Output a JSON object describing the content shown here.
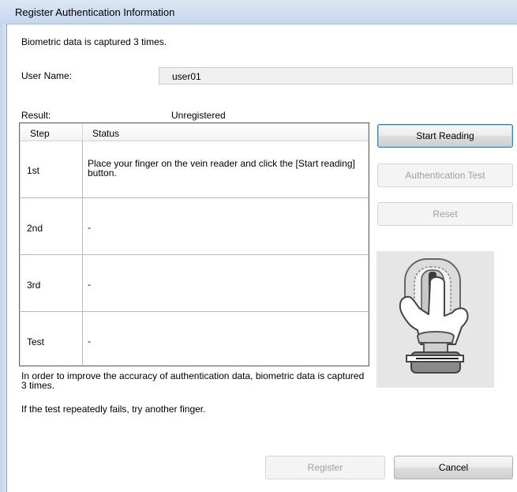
{
  "window": {
    "title": "Register Authentication Information"
  },
  "info": {
    "capture_text": "Biometric data is captured 3 times."
  },
  "user": {
    "label": "User Name:",
    "value": "user01"
  },
  "result": {
    "label": "Result:",
    "value": "Unregistered"
  },
  "table": {
    "headers": [
      "Step",
      "Status"
    ],
    "rows": [
      {
        "step": "1st",
        "status": "Place your finger on the vein reader and click the [Start reading] button."
      },
      {
        "step": "2nd",
        "status": "-"
      },
      {
        "step": "3rd",
        "status": "-"
      },
      {
        "step": "Test",
        "status": "-"
      }
    ]
  },
  "buttons": {
    "start_reading": "Start Reading",
    "auth_test": "Authentication Test",
    "reset": "Reset",
    "register": "Register",
    "cancel": "Cancel"
  },
  "notes": {
    "accuracy": "In order to improve the accuracy of authentication data, biometric data is captured 3 times.",
    "retry": "If the test repeatedly fails, try another finger."
  },
  "illustration": {
    "icon": "finger-vein-reader-icon"
  }
}
